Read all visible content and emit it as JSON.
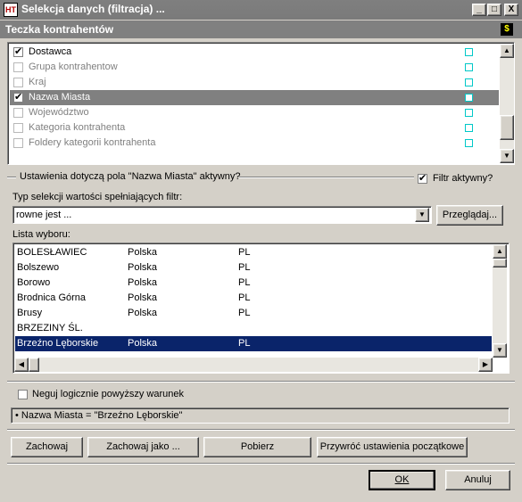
{
  "window": {
    "icon_text": "HT",
    "title": "Selekcja danych (filtracja) ...",
    "minimize": "_",
    "maximize": "□",
    "close": "X"
  },
  "header": {
    "title": "Teczka kontrahentów",
    "icon_glyph": "$"
  },
  "field_list": {
    "items": [
      {
        "label": "Dostawca",
        "checked": true,
        "active": true,
        "selected": false
      },
      {
        "label": "Grupa kontrahentow",
        "checked": false,
        "active": false,
        "selected": false
      },
      {
        "label": "Kraj",
        "checked": false,
        "active": false,
        "selected": false
      },
      {
        "label": "Nazwa Miasta",
        "checked": true,
        "active": true,
        "selected": true
      },
      {
        "label": "Województwo",
        "checked": false,
        "active": false,
        "selected": false
      },
      {
        "label": "Kategoria kontrahenta",
        "checked": false,
        "active": false,
        "selected": false
      },
      {
        "label": "Foldery kategorii kontrahenta",
        "checked": false,
        "active": false,
        "selected": false
      }
    ],
    "scroll_up": "▲",
    "scroll_down": "▼"
  },
  "settings": {
    "group_label": "Ustawienia dotyczą pola \"Nazwa Miasta\" aktywny?",
    "filter_active_label": "Filtr aktywny?",
    "filter_active_checked": true,
    "selection_type_label": "Typ selekcji wartości spełniających filtr:",
    "selection_type_value": "rowne jest ...",
    "combo_arrow": "▼",
    "browse_button": "Przeglądaj..."
  },
  "choice_list": {
    "label": "Lista wyboru:",
    "rows": [
      {
        "city": "BOLESŁAWIEC",
        "country": "Polska",
        "code": "PL",
        "selected": false
      },
      {
        "city": "Bolszewo",
        "country": "Polska",
        "code": "PL",
        "selected": false
      },
      {
        "city": "Borowo",
        "country": "Polska",
        "code": "PL",
        "selected": false
      },
      {
        "city": "Brodnica Górna",
        "country": "Polska",
        "code": "PL",
        "selected": false
      },
      {
        "city": "Brusy",
        "country": "Polska",
        "code": "PL",
        "selected": false
      },
      {
        "city": "BRZEZINY ŚL.",
        "country": "",
        "code": "",
        "selected": false
      },
      {
        "city": "Brzeźno Lęborskie",
        "country": "Polska",
        "code": "PL",
        "selected": true
      }
    ],
    "scroll_up": "▲",
    "scroll_down": "▼",
    "scroll_left": "◀",
    "scroll_right": "▶"
  },
  "negate": {
    "label": "Neguj logicznie powyższy warunek",
    "checked": false
  },
  "summary": "• Nazwa Miasta = \"Brzeźno Lęborskie\"",
  "actions": {
    "save": "Zachowaj",
    "save_as": "Zachowaj jako ...",
    "load": "Pobierz",
    "restore": "Przywróć ustawienia początkowe"
  },
  "dialog": {
    "ok": "OK",
    "cancel": "Anuluj"
  }
}
